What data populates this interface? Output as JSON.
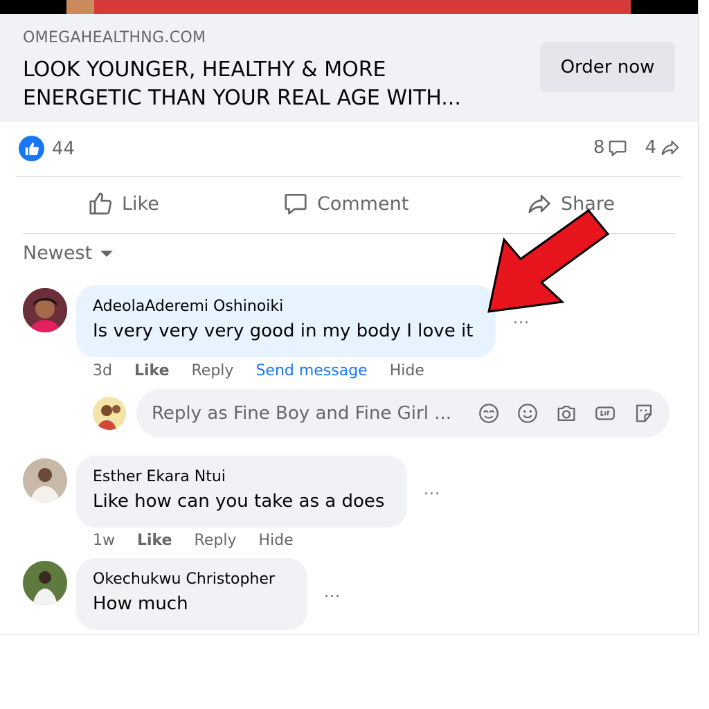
{
  "link_preview": {
    "domain": "OMEGAHEALTHNG.COM",
    "headline_line1": "LOOK YOUNGER, HEALTHY & MORE",
    "headline_line2": "ENERGETIC THAN YOUR REAL AGE WITH...",
    "button_label": "Order now"
  },
  "stats": {
    "reaction_count": "44",
    "comment_count": "8",
    "share_count": "4"
  },
  "actions": {
    "like": "Like",
    "comment": "Comment",
    "share": "Share"
  },
  "sort": {
    "label": "Newest"
  },
  "comments": [
    {
      "author": "AdeolaAderemi Oshinoiki",
      "text": "Is very very very good in my body I love it",
      "time": "3d",
      "like": "Like",
      "reply": "Reply",
      "send_message": "Send message",
      "hide": "Hide"
    },
    {
      "author": "Esther Ekara Ntui",
      "text": "Like how can you take as a does",
      "time": "1w",
      "like": "Like",
      "reply": "Reply",
      "hide": "Hide"
    },
    {
      "author": "Okechukwu Christopher",
      "text": "How much"
    }
  ],
  "reply_box": {
    "placeholder": "Reply as Fine Boy and Fine Girl ..."
  },
  "more_label": "...",
  "colors": {
    "accent": "#1877f2",
    "arrow": "#e8151e"
  }
}
